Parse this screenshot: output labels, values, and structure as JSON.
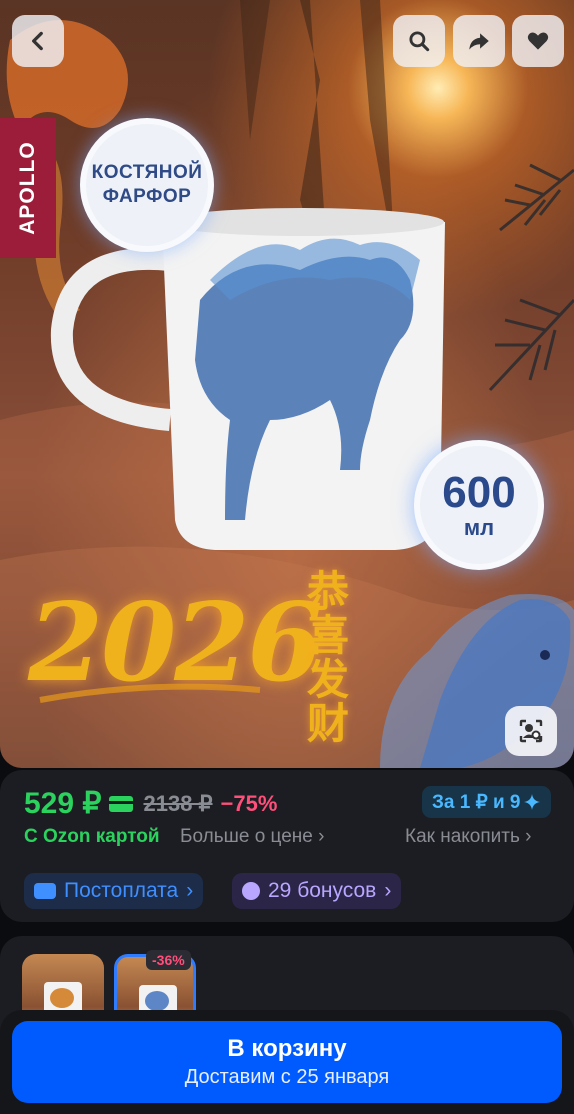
{
  "hero": {
    "brand_badge": "APOLLO",
    "material_badge_line1": "КОСТЯНОЙ",
    "material_badge_line2": "ФАРФОР",
    "volume_number": "600",
    "volume_unit": "мл",
    "year": "2026",
    "chinese_chars": [
      "恭",
      "喜",
      "发",
      "财"
    ],
    "buttons": {
      "back": "back-icon",
      "search": "search-icon",
      "share": "share-icon",
      "favorite": "heart-icon",
      "lens": "image-search-icon"
    }
  },
  "price": {
    "current": "529 ₽",
    "old": "2138 ₽",
    "discount": "−75%",
    "points_badge": "За 1 ₽ и 9",
    "ozon_card": "С Ozon картой",
    "more_price": "Больше о цене",
    "how_collect": "Как накопить",
    "postpay": "Постоплата",
    "bonuses": "29 бонусов"
  },
  "variants": {
    "discount_badge": "-36%"
  },
  "cart": {
    "button_label": "В корзину",
    "delivery": "Доставим с 25 января"
  },
  "colors": {
    "accent_green": "#2bd25e",
    "accent_blue": "#005bff",
    "discount_pink": "#ff4f7a",
    "brand_red": "#9c1d3a"
  }
}
